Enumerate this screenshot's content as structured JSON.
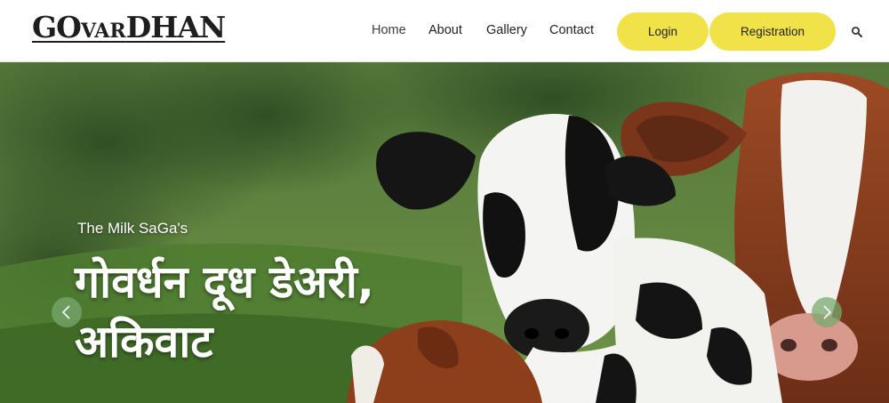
{
  "brand": {
    "part1": "GO",
    "part2": "VAR",
    "part3": "DHAN"
  },
  "nav": {
    "home": "Home",
    "about": "About",
    "gallery": "Gallery",
    "contact": "Contact",
    "login": "Login",
    "registration": "Registration",
    "search_icon": "search-icon"
  },
  "hero": {
    "tagline": "The Milk SaGa's",
    "headline": "गोवर्धन दूध डेअरी, अकिवाट",
    "prev_icon": "chevron-left-icon",
    "next_icon": "chevron-right-icon"
  },
  "colors": {
    "accent": "#f2e24a",
    "text": "#222222",
    "hero_green": "#4b7236"
  }
}
